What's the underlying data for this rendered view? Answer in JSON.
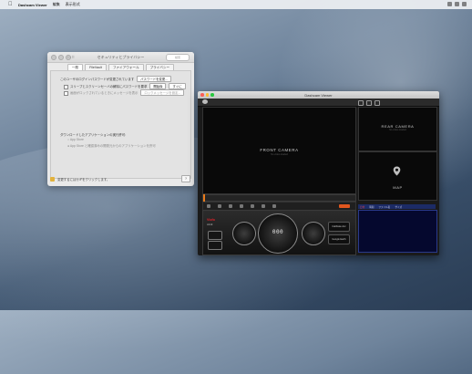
{
  "menubar": {
    "apple": "",
    "app_name": "Dashcam Viewer",
    "items": [
      "編集",
      "表示形式"
    ]
  },
  "preferences": {
    "title": "セキュリティとプライバシー",
    "search_placeholder": "検索",
    "tabs": [
      "一般",
      "FileVault",
      "ファイアウォール",
      "プライバシー"
    ],
    "row1_label": "このユーザのログインパスワードが変更されています",
    "row1_button": "パスワードを変更...",
    "row2_label": "スリープとスクリーンセーバの解除にパスワードを要求",
    "row2_select1": "開始後",
    "row2_select2": "すぐに",
    "row3_label": "画面がロックされているときにメッセージを表示",
    "row3_button": "ロックメッセージを設定...",
    "section_label": "ダウンロードしたアプリケーションの実行許可:",
    "radio1": "App Store",
    "radio2": "App Store と確認済みの開発元からのアプリケーションを許可",
    "lock_text": "変更するにはカギをクリックします。",
    "help_label": "?",
    "advanced_label": "詳細..."
  },
  "viewer": {
    "title": "Dashcam Viewer",
    "front_label": "FRONT CAMERA",
    "front_sub": "No video loaded",
    "rear_label": "REAR CAMERA",
    "rear_sub": "No video loaded",
    "map_label": "MAP",
    "brand": "Viofo",
    "brand_sub": "A119",
    "speed_display": "000",
    "pill1": "Calibrate Acc",
    "pill2": "Google Earth",
    "file_headers": [
      "日付",
      "時刻",
      "ファイル名",
      "サイズ"
    ]
  },
  "colors": {
    "accent_orange": "#e87a1b",
    "rec_orange": "#e0561e",
    "brand_red": "#e2222a",
    "filelist_bg": "#05082e"
  }
}
